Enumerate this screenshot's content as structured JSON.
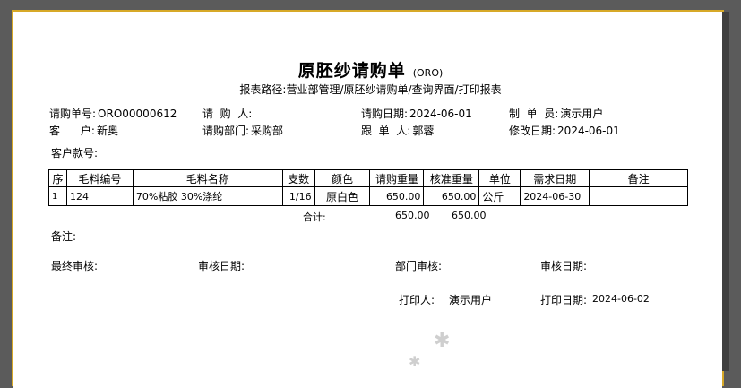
{
  "report": {
    "title": "原胚纱请购单",
    "code": "(ORO)",
    "path_label": "报表路径:",
    "path_value": "营业部管理/原胚纱请购单/查询界面/打印报表"
  },
  "header": {
    "order_no_label": "请购单号:",
    "order_no": "ORO00000612",
    "requester_label": "请  购  人:",
    "requester": "",
    "order_date_label": "请购日期:",
    "order_date": "2024-06-01",
    "maker_label": "制  单  员:",
    "maker": "演示用户",
    "customer_label": "客      户:",
    "customer": "新奥",
    "dept_label": "请购部门:",
    "dept": "采购部",
    "follower_label": "跟  单  人:",
    "follower": "郭蓉",
    "modify_date_label": "修改日期:",
    "modify_date": "2024-06-01",
    "style_no_label": "客户款号:",
    "style_no": ""
  },
  "table": {
    "columns": [
      "序",
      "毛料编号",
      "毛料名称",
      "支数",
      "颜色",
      "请购重量",
      "核准重量",
      "单位",
      "需求日期",
      "备注"
    ],
    "rows": [
      [
        "1",
        "124",
        "70%粘胶 30%涤纶",
        "1/16",
        "原白色",
        "650.00",
        "650.00",
        "公斤",
        "2024-06-30",
        ""
      ]
    ],
    "total_label": "合计:",
    "total_request": "650.00",
    "total_approved": "650.00"
  },
  "footer": {
    "remark_label": "备注:",
    "final_audit_label": "最终审核:",
    "audit_date_label": "审核日期:",
    "dept_audit_label": "部门审核:",
    "audit_date2_label": "审核日期:",
    "printer_label": "打印人:",
    "printer": "演示用户",
    "print_date_label": "打印日期:",
    "print_date": "2024-06-02"
  },
  "colors": {
    "frame": "#d7a928",
    "background": "#5b5b5b",
    "paper": "#ffffff"
  }
}
